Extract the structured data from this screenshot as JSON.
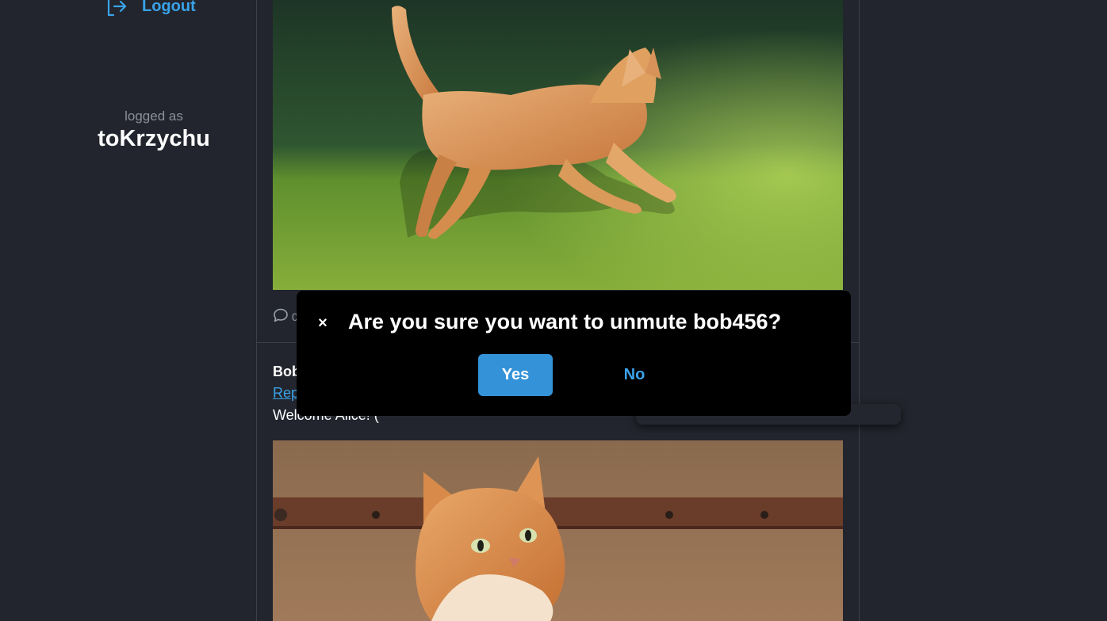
{
  "sidebar": {
    "logout_label": "Logout",
    "logged_caption": "logged as",
    "username": "toKrzychu"
  },
  "feed": {
    "post1": {
      "comment_count": "0"
    },
    "post2": {
      "author": "Bob",
      "reply_link": "Rep",
      "text": "Welcome Alice! ("
    }
  },
  "modal": {
    "close_glyph": "×",
    "title": "Are you sure you want to unmute bob456?",
    "yes_label": "Yes",
    "no_label": "No"
  },
  "colors": {
    "background": "#22252d",
    "accent": "#3aa3ea",
    "button_primary": "#3493d8",
    "modal_background": "#000000"
  },
  "icons": {
    "logout": "logout-icon",
    "comment": "comment-icon",
    "close": "close-icon"
  }
}
